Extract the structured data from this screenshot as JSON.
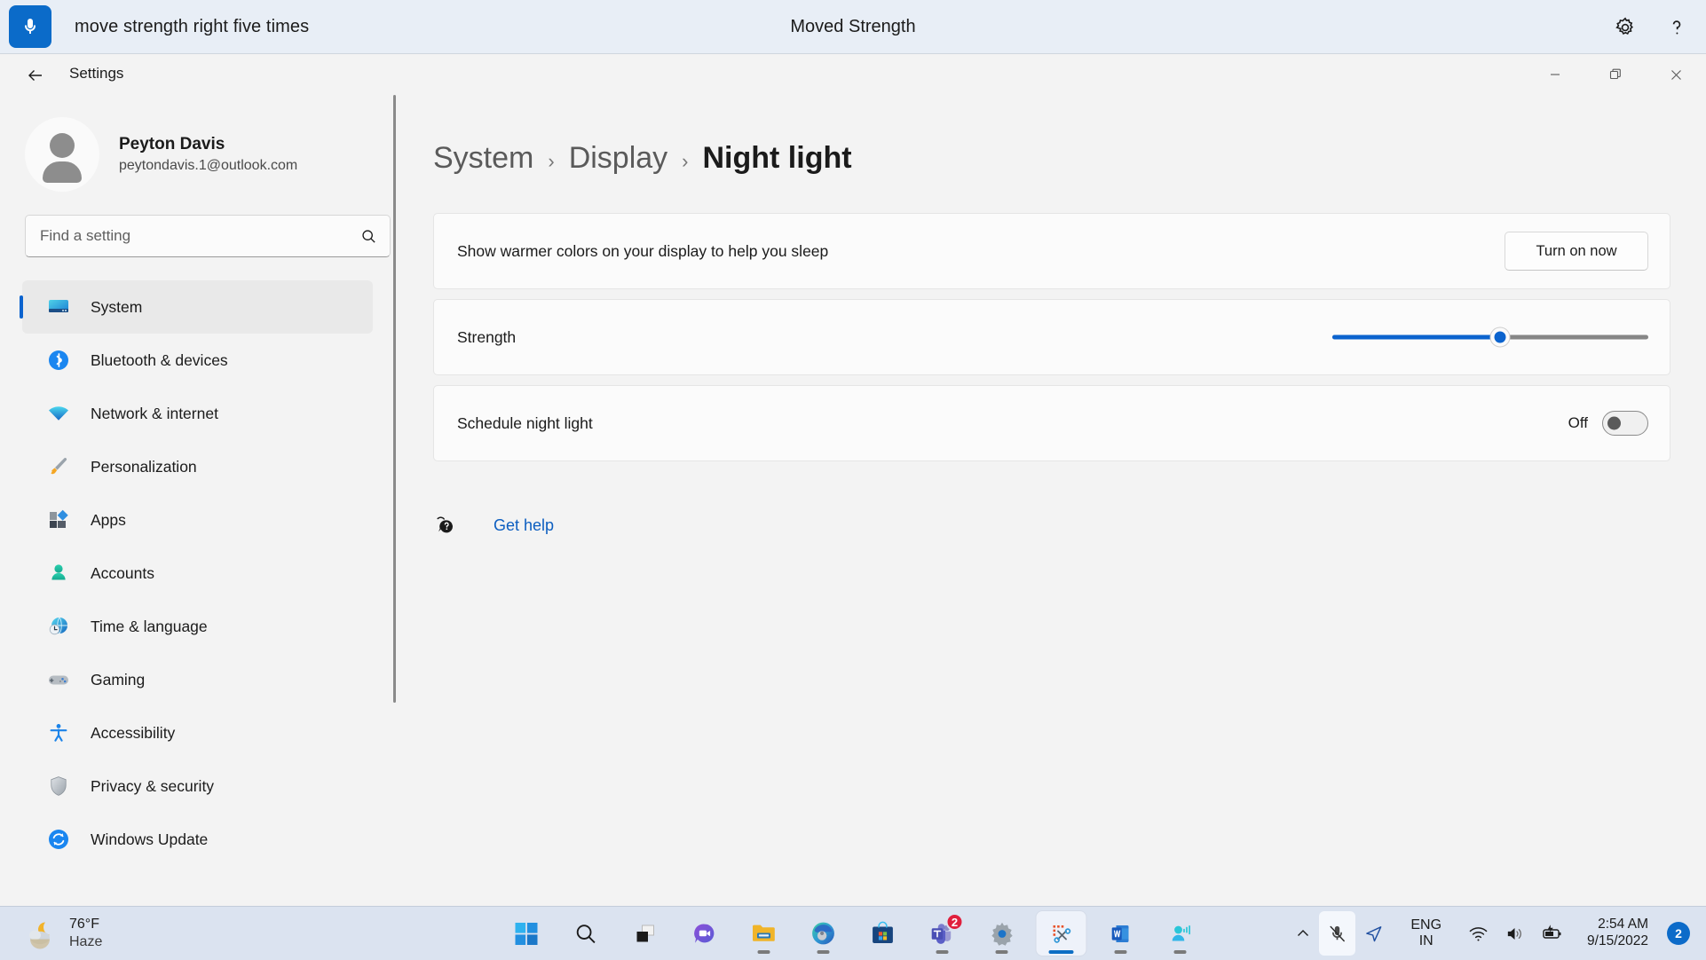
{
  "voice_bar": {
    "mic_icon": "microphone-icon",
    "command_text": "move strength right five times",
    "status_text": "Moved Strength",
    "settings_icon": "gear-icon",
    "help_icon": "question-mark-icon",
    "accent_color": "#0b6bc9",
    "background_color": "#e8eef6"
  },
  "window": {
    "title": "Settings",
    "back_icon": "back-arrow-icon",
    "controls": {
      "minimize": "minimize-icon",
      "restore": "restore-icon",
      "close": "close-icon"
    }
  },
  "sidebar": {
    "profile": {
      "name": "Peyton Davis",
      "email": "peytondavis.1@outlook.com",
      "avatar_icon": "person-avatar-icon"
    },
    "search": {
      "placeholder": "Find a setting",
      "value": "",
      "icon": "search-icon"
    },
    "items": [
      {
        "label": "System",
        "icon": "monitor-icon",
        "selected": true
      },
      {
        "label": "Bluetooth & devices",
        "icon": "bluetooth-icon",
        "selected": false
      },
      {
        "label": "Network & internet",
        "icon": "wifi-icon",
        "selected": false
      },
      {
        "label": "Personalization",
        "icon": "paintbrush-icon",
        "selected": false
      },
      {
        "label": "Apps",
        "icon": "apps-grid-icon",
        "selected": false
      },
      {
        "label": "Accounts",
        "icon": "person-icon",
        "selected": false
      },
      {
        "label": "Time & language",
        "icon": "clock-globe-icon",
        "selected": false
      },
      {
        "label": "Gaming",
        "icon": "gamepad-icon",
        "selected": false
      },
      {
        "label": "Accessibility",
        "icon": "accessibility-person-icon",
        "selected": false
      },
      {
        "label": "Privacy & security",
        "icon": "shield-icon",
        "selected": false
      },
      {
        "label": "Windows Update",
        "icon": "update-refresh-icon",
        "selected": false
      }
    ]
  },
  "main": {
    "breadcrumb": [
      {
        "label": "System",
        "current": false
      },
      {
        "label": "Display",
        "current": false
      },
      {
        "label": "Night light",
        "current": true
      }
    ],
    "breadcrumb_separator": "›",
    "cards": {
      "warm_colors": {
        "label": "Show warmer colors on your display to help you sleep",
        "button_label": "Turn on now"
      },
      "strength": {
        "label": "Strength",
        "value_percent": 53,
        "min": 0,
        "max": 100,
        "fill_color": "#0b63ce",
        "track_color": "#868686"
      },
      "schedule": {
        "label": "Schedule night light",
        "state_label": "Off",
        "checked": false
      }
    },
    "get_help": {
      "label": "Get help",
      "icon": "help-chat-icon",
      "link_color": "#0c5ec0"
    }
  },
  "taskbar": {
    "weather": {
      "temperature": "76°F",
      "condition": "Haze",
      "icon": "moon-cloud-icon"
    },
    "apps": [
      {
        "name": "start",
        "icon": "windows-logo-icon",
        "running": false,
        "active": false,
        "badge": ""
      },
      {
        "name": "search",
        "icon": "search-icon",
        "running": false,
        "active": false,
        "badge": ""
      },
      {
        "name": "task-view",
        "icon": "task-view-icon",
        "running": false,
        "active": false,
        "badge": ""
      },
      {
        "name": "chat",
        "icon": "chat-video-icon",
        "running": false,
        "active": false,
        "badge": ""
      },
      {
        "name": "file-explorer",
        "icon": "folder-icon",
        "running": true,
        "active": false,
        "badge": ""
      },
      {
        "name": "microsoft-edge",
        "icon": "edge-icon",
        "running": true,
        "active": false,
        "badge": ""
      },
      {
        "name": "microsoft-store",
        "icon": "store-icon",
        "running": false,
        "active": false,
        "badge": ""
      },
      {
        "name": "microsoft-teams",
        "icon": "teams-icon",
        "running": true,
        "active": false,
        "badge": "2"
      },
      {
        "name": "settings",
        "icon": "gear-icon",
        "running": true,
        "active": false,
        "badge": ""
      },
      {
        "name": "snipping-tool",
        "icon": "snip-scissors-icon",
        "running": true,
        "active": true,
        "badge": ""
      },
      {
        "name": "microsoft-word",
        "icon": "word-icon",
        "running": true,
        "active": false,
        "badge": ""
      },
      {
        "name": "voice-access",
        "icon": "voice-access-icon",
        "running": true,
        "active": false,
        "badge": ""
      }
    ],
    "tray": {
      "overflow_icon": "chevron-up-icon",
      "mic_icon": "microphone-muted-icon",
      "location_icon": "location-arrow-icon",
      "language_line1": "ENG",
      "language_line2": "IN",
      "wifi_icon": "wifi-icon",
      "volume_icon": "speaker-icon",
      "battery_icon": "battery-charging-icon",
      "time": "2:54 AM",
      "date": "9/15/2022",
      "notification_count": "2"
    }
  }
}
